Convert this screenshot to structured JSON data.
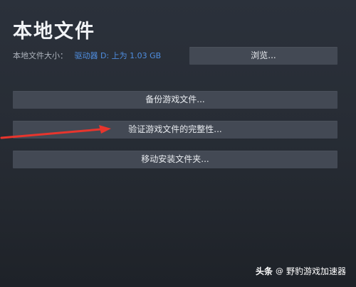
{
  "dialog": {
    "title": "本地文件",
    "size_label": "本地文件大小：",
    "size_value": "驱动器 D: 上为 1.03 GB"
  },
  "buttons": {
    "browse": "浏览...",
    "backup": "备份游戏文件...",
    "verify": "验证游戏文件的完整性...",
    "move": "移动安装文件夹..."
  },
  "annotation": {
    "arrow_color": "#e8352d"
  },
  "watermark": {
    "brand": "头条",
    "at": "@",
    "account": "野豹游戏加速器"
  },
  "colors": {
    "background": "#2b313b",
    "button": "#434954",
    "accent_link": "#4f8ee0"
  }
}
